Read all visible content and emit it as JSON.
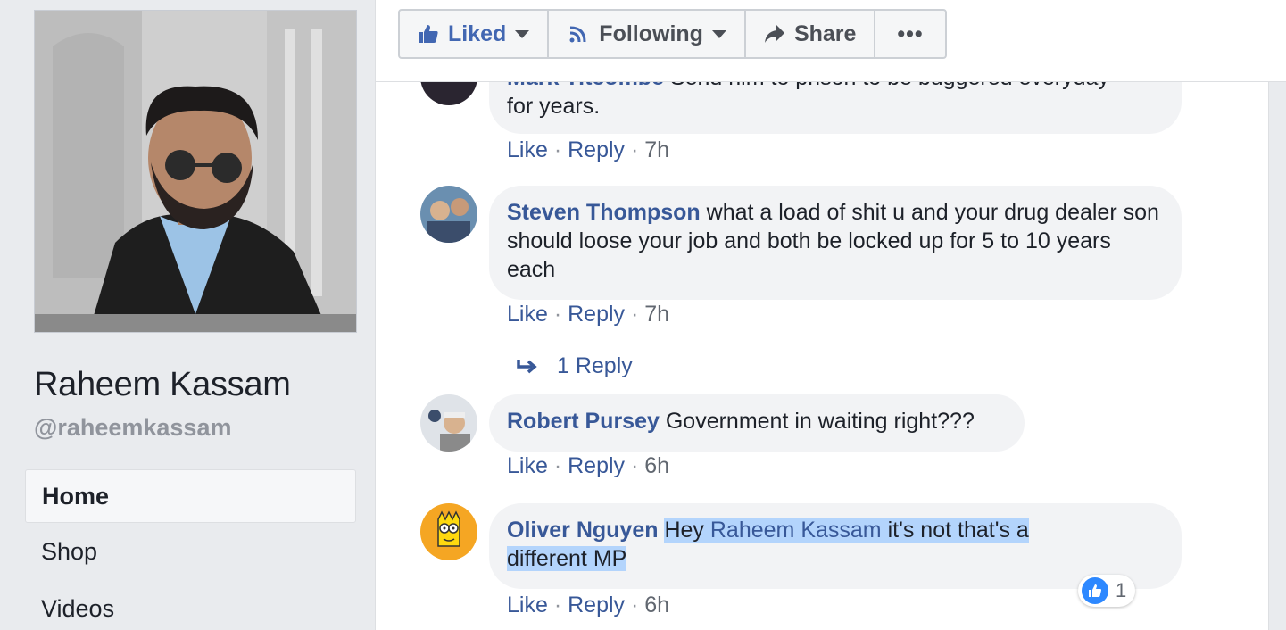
{
  "sidebar": {
    "page_name": "Raheem Kassam",
    "handle": "@raheemkassam",
    "nav": [
      {
        "label": "Home"
      },
      {
        "label": "Shop"
      },
      {
        "label": "Videos"
      }
    ]
  },
  "toolbar": {
    "liked_label": "Liked",
    "following_label": "Following",
    "share_label": "Share",
    "more_label": "•••"
  },
  "comments": [
    {
      "author": "Mark Titcombe",
      "text_first_line": "Send him to prison to be buggered everyday",
      "text_rest": "for years.",
      "like": "Like",
      "reply": "Reply",
      "time": "7h"
    },
    {
      "author": "Steven Thompson",
      "text": "what a load of shit u and your drug dealer son should loose your job and both be locked up for 5 to 10 years each",
      "like": "Like",
      "reply": "Reply",
      "time": "7h",
      "replies_label": "1 Reply"
    },
    {
      "author": "Robert Pursey",
      "text": "Government in waiting right???",
      "like": "Like",
      "reply": "Reply",
      "time": "6h"
    },
    {
      "author": "Oliver Nguyen",
      "text_pre": "Hey",
      "mention": "Raheem Kassam",
      "text_post": "it's not that's a",
      "text_line2": "different MP",
      "like": "Like",
      "reply": "Reply",
      "time": "6h",
      "reaction_count": "1"
    }
  ],
  "separator": "·",
  "colors": {
    "link": "#385898",
    "accent": "#4267b2",
    "bubble": "#f2f3f5",
    "highlight": "#b3d4fc"
  }
}
